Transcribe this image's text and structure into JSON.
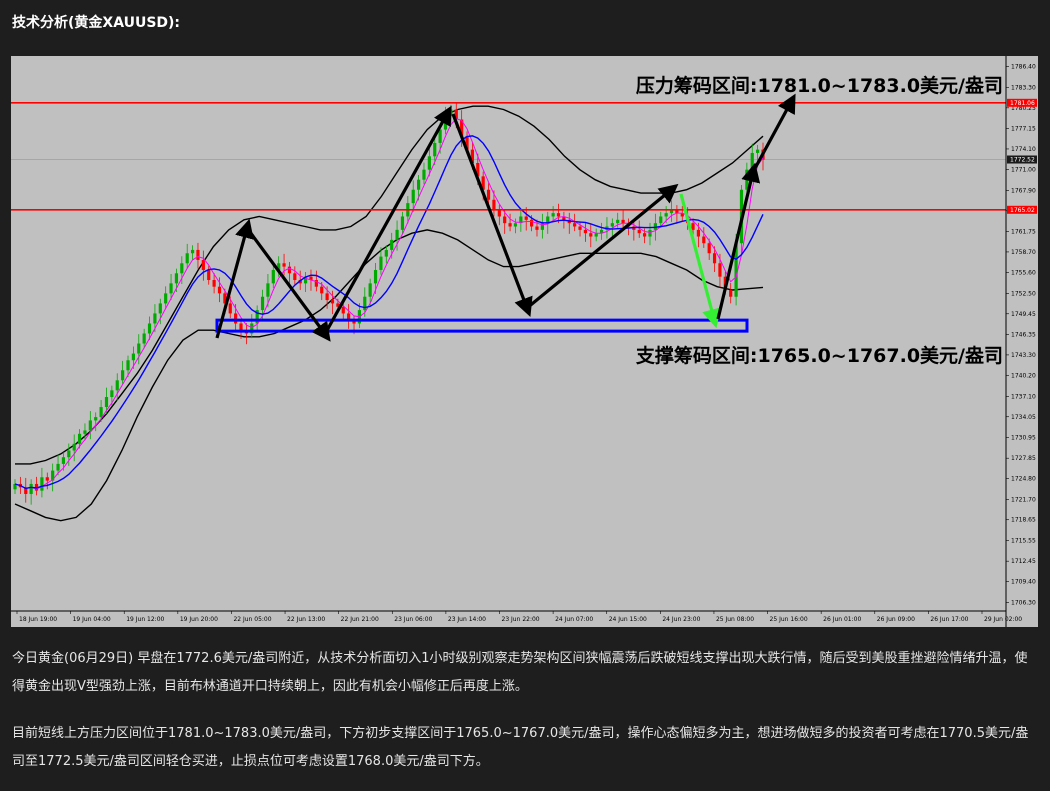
{
  "header": {
    "title": "技术分析(黄金XAUUSD):"
  },
  "chart_data": {
    "type": "candlestick",
    "title": "",
    "xlabel": "",
    "ylabel": "",
    "ylim": [
      1705.0,
      1788.0
    ],
    "y_ticks": [
      "1786.40",
      "1783.30",
      "1780.25",
      "1777.15",
      "1774.10",
      "1771.00",
      "1767.90",
      "1764.85",
      "1761.75",
      "1758.70",
      "1755.60",
      "1752.50",
      "1749.45",
      "1746.35",
      "1743.30",
      "1740.20",
      "1737.10",
      "1734.05",
      "1730.95",
      "1727.85",
      "1724.80",
      "1721.70",
      "1718.65",
      "1715.55",
      "1712.45",
      "1709.40",
      "1706.30"
    ],
    "x_ticks": [
      "18 Jun 19:00",
      "19 Jun 04:00",
      "19 Jun 12:00",
      "19 Jun 20:00",
      "22 Jun 05:00",
      "22 Jun 13:00",
      "22 Jun 21:00",
      "23 Jun 06:00",
      "23 Jun 14:00",
      "23 Jun 22:00",
      "24 Jun 07:00",
      "24 Jun 15:00",
      "24 Jun 23:00",
      "25 Jun 08:00",
      "25 Jun 16:00",
      "26 Jun 01:00",
      "26 Jun 09:00",
      "26 Jun 17:00",
      "29 Jun 02:00"
    ],
    "current_price": "1772.52",
    "levels": [
      {
        "value": 1781.0,
        "tag": "1781.06",
        "color": "#ff0000"
      },
      {
        "value": 1765.0,
        "tag": "1765.02",
        "color": "#ff0000"
      }
    ],
    "resistance_label": "压力筹码区间:1781.0~1783.0美元/盎司",
    "support_label": "支撑筹码区间:1765.0~1767.0美元/盎司",
    "support_box": {
      "low": 1746.6,
      "high": 1748.2,
      "color": "#0000ff"
    },
    "colors": {
      "bull": "#00aa00",
      "bear": "#ff0000",
      "ma_fast": "#0000ff",
      "ma_slow": "#ff00ff",
      "band": "#000000",
      "background": "#c0c0c0"
    },
    "candle_closes": [
      1724,
      1723.5,
      1722.5,
      1724,
      1723,
      1725,
      1724.5,
      1726,
      1727,
      1728,
      1729,
      1730,
      1731.5,
      1732,
      1733.5,
      1734,
      1735.5,
      1737,
      1738,
      1739.5,
      1741,
      1742.5,
      1743.5,
      1745,
      1746.5,
      1748,
      1749.5,
      1751,
      1752.5,
      1754,
      1755.5,
      1757,
      1758.5,
      1759,
      1757.5,
      1756,
      1754.5,
      1753.5,
      1752.5,
      1751,
      1749.5,
      1748,
      1747,
      1746.5,
      1748,
      1750,
      1752,
      1754,
      1756,
      1757,
      1756.5,
      1755.5,
      1754.5,
      1754,
      1755,
      1754.5,
      1753.5,
      1752.5,
      1751.5,
      1751,
      1750.5,
      1749.5,
      1748.5,
      1748,
      1750,
      1752,
      1754,
      1756,
      1758,
      1759,
      1760.5,
      1762,
      1764,
      1766,
      1768,
      1769.5,
      1771,
      1773,
      1775,
      1777,
      1779,
      1780,
      1778.5,
      1776,
      1774,
      1772,
      1770,
      1768,
      1766.5,
      1765,
      1764,
      1763,
      1762.5,
      1763,
      1764,
      1763.5,
      1762.5,
      1762,
      1763,
      1764,
      1764.5,
      1764,
      1763.5,
      1763,
      1762.5,
      1762,
      1761.5,
      1761,
      1761.5,
      1762,
      1762.5,
      1763,
      1763.5,
      1763,
      1762.5,
      1762,
      1761.5,
      1761,
      1762,
      1763,
      1764,
      1764.5,
      1765,
      1764.5,
      1764,
      1763,
      1762,
      1761,
      1760,
      1758.5,
      1757,
      1755,
      1753,
      1752,
      1760,
      1768,
      1771,
      1773.5,
      1774,
      1772.5
    ],
    "bollinger_upper": [
      1727,
      1727,
      1727.5,
      1728.5,
      1730,
      1732,
      1734.5,
      1737.5,
      1740.5,
      1744,
      1748,
      1752,
      1756,
      1759.5,
      1762,
      1763.5,
      1764,
      1763.5,
      1763,
      1762.5,
      1762,
      1762,
      1762.5,
      1764,
      1767,
      1770.5,
      1774,
      1777,
      1779,
      1780,
      1780.5,
      1780.5,
      1780,
      1779,
      1777.5,
      1775.5,
      1773,
      1771,
      1769.5,
      1768.5,
      1768,
      1767.5,
      1767.5,
      1767.5,
      1768,
      1769,
      1770.5,
      1772,
      1774,
      1776
    ],
    "bollinger_lower": [
      1721,
      1720,
      1719,
      1718.5,
      1719,
      1721,
      1724.5,
      1729,
      1734,
      1738.5,
      1742.5,
      1745.5,
      1747,
      1747,
      1746.5,
      1746,
      1746,
      1746.5,
      1747.5,
      1748.5,
      1750,
      1752,
      1754.5,
      1757,
      1759,
      1760.5,
      1761.5,
      1762,
      1761.5,
      1760.5,
      1759,
      1757.5,
      1756.5,
      1756.5,
      1757,
      1757.5,
      1758,
      1758.5,
      1758.5,
      1758.5,
      1758.5,
      1758.5,
      1758,
      1757,
      1756,
      1754.5,
      1753.5,
      1753,
      1753.2,
      1753.4
    ]
  },
  "article": {
    "paragraph1": "今日黄金(06月29日) 早盘在1772.6美元/盎司附近，从技术分析面切入1小时级别观察走势架构区间狭幅震荡后跌破短线支撑出现大跌行情，随后受到美股重挫避险情绪升温，使得黄金出现V型强劲上涨，目前布林通道开口持续朝上，因此有机会小幅修正后再度上涨。",
    "paragraph2": "目前短线上方压力区间位于1781.0~1783.0美元/盎司，下方初步支撑区间于1765.0~1767.0美元/盎司，操作心态偏短多为主，想进场做短多的投资者可考虑在1770.5美元/盎司至1772.5美元/盎司区间轻仓买进，止损点位可考虑设置1768.0美元/盎司下方。"
  }
}
